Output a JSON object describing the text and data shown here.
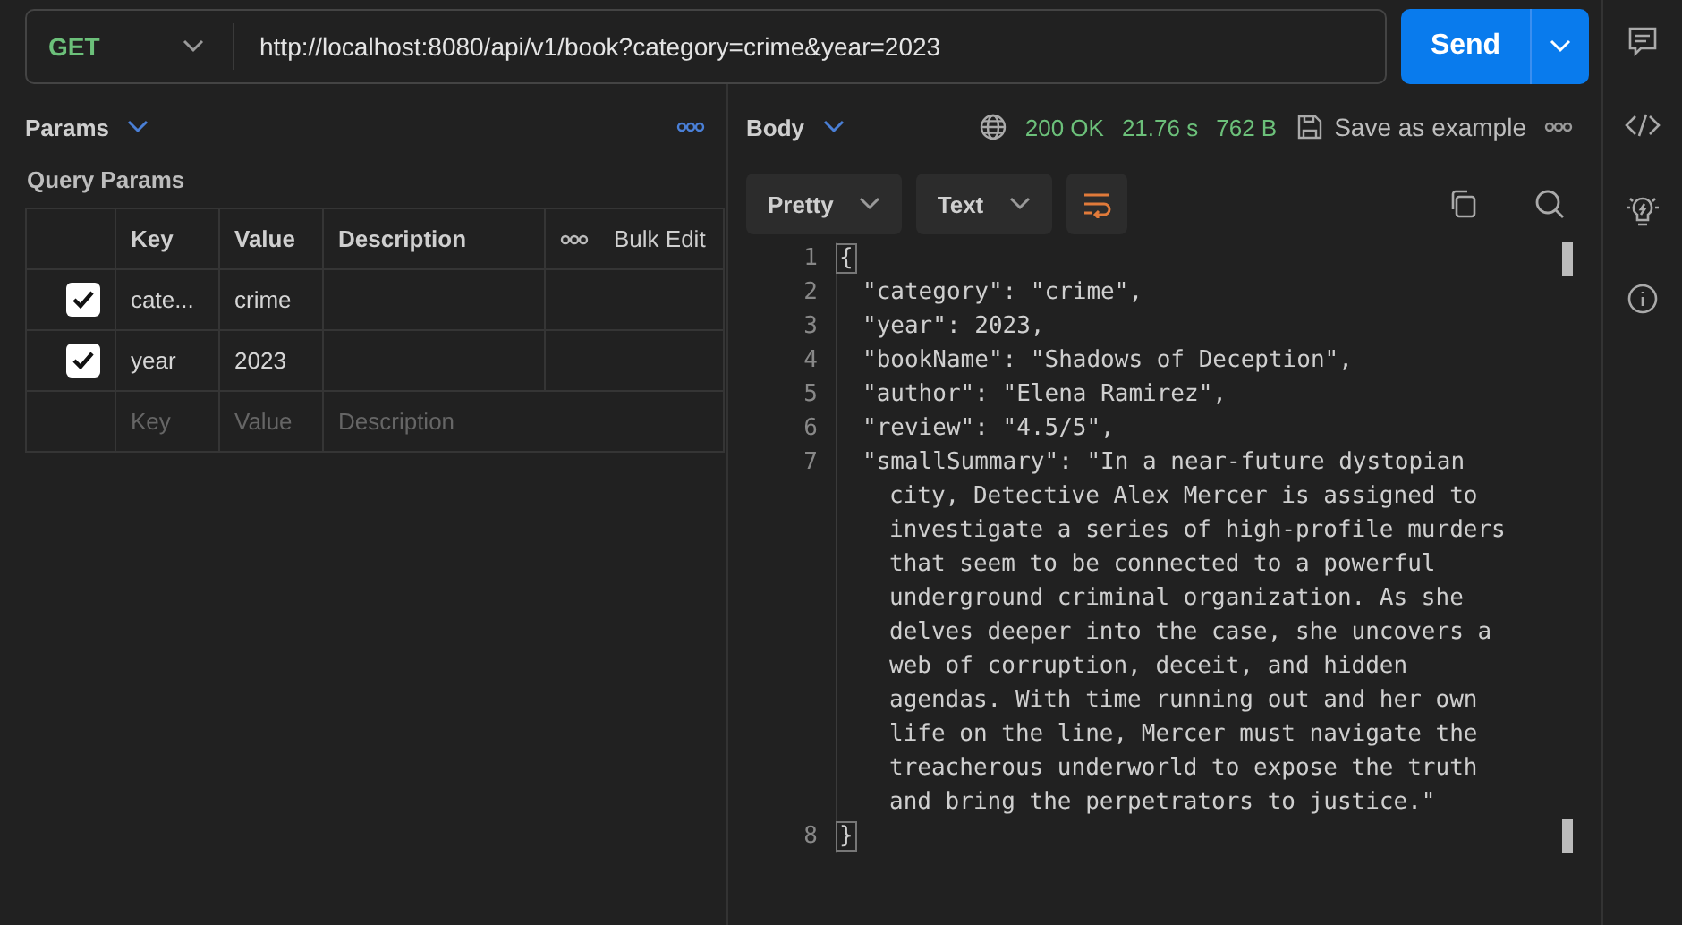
{
  "request": {
    "method": "GET",
    "url": "http://localhost:8080/api/v1/book?category=crime&year=2023",
    "send_label": "Send"
  },
  "params": {
    "tab_label": "Params",
    "section_title": "Query Params",
    "columns": [
      "Key",
      "Value",
      "Description"
    ],
    "bulk_edit": "Bulk Edit",
    "rows": [
      {
        "key": "cate...",
        "value": "crime",
        "checked": true
      },
      {
        "key": "year",
        "value": "2023",
        "checked": true
      }
    ],
    "placeholder_row": {
      "key": "Key",
      "value": "Value",
      "description": "Description"
    }
  },
  "response": {
    "tab_label": "Body",
    "status": "200 OK",
    "time": "21.76 s",
    "size": "762 B",
    "save_label": "Save as example",
    "format": "Pretty",
    "type": "Text",
    "lines": [
      {
        "number": "1",
        "segments": [
          "{"
        ],
        "bracket": true
      },
      {
        "number": "2",
        "segments": [
          "\"category\": \"crime\","
        ],
        "bracket": false
      },
      {
        "number": "3",
        "segments": [
          "\"year\": 2023,"
        ],
        "bracket": false
      },
      {
        "number": "4",
        "segments": [
          "\"bookName\": \"Shadows of Deception\","
        ],
        "bracket": false
      },
      {
        "number": "5",
        "segments": [
          "\"author\": \"Elena Ramirez\","
        ],
        "bracket": false
      },
      {
        "number": "6",
        "segments": [
          "\"review\": \"4.5/5\","
        ],
        "bracket": false
      },
      {
        "number": "7",
        "segments": [
          "\"smallSummary\": \"In a near-future dystopian",
          "city, Detective Alex Mercer is assigned to",
          "investigate a series of high-profile murders",
          "that seem to be connected to a powerful",
          "underground criminal organization. As she",
          "delves deeper into the case, she uncovers a",
          "web of corruption, deceit, and hidden",
          "agendas. With time running out and her own",
          "life on the line, Mercer must navigate the",
          "treacherous underworld to expose the truth",
          "and bring the perpetrators to justice.\""
        ],
        "bracket": false
      },
      {
        "number": "8",
        "segments": [
          "}"
        ],
        "bracket": true
      }
    ]
  }
}
